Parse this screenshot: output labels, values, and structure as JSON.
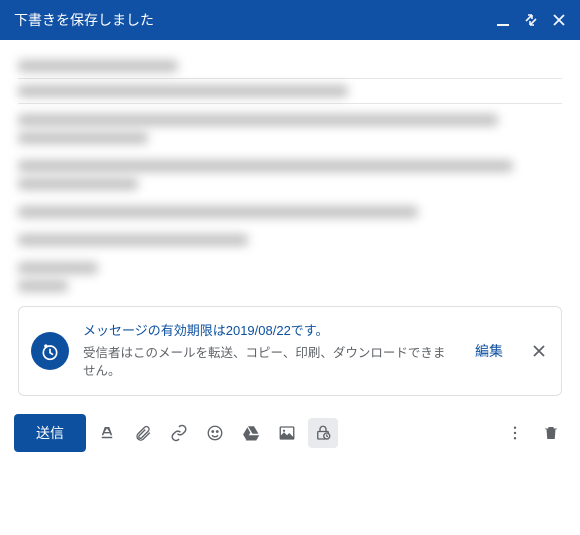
{
  "titlebar": {
    "text": "下書きを保存しました"
  },
  "confidential": {
    "title": "メッセージの有効期限は2019/08/22です。",
    "body": "受信者はこのメールを転送、コピー、印刷、ダウンロードできません。",
    "edit": "編集"
  },
  "toolbar": {
    "send": "送信"
  }
}
